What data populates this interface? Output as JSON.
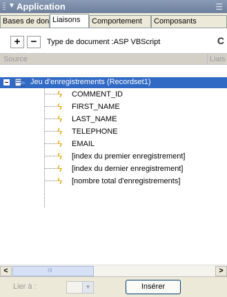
{
  "panel": {
    "title": "Application",
    "menu_icon": "panel-options-icon"
  },
  "tabs": [
    {
      "label": "Bases de donn",
      "active": false
    },
    {
      "label": "Liaisons",
      "active": true
    },
    {
      "label": "Comportement",
      "active": false
    },
    {
      "label": "Composants",
      "active": false
    }
  ],
  "toolbar": {
    "add_label": "+",
    "remove_label": "−",
    "doctype_label": "Type de document :ASP VBScript",
    "refresh_label": "C"
  },
  "columns": {
    "source": "Source",
    "binding": "Liais"
  },
  "tree": {
    "root_label": "Jeu d'enregistrements (Recordset1)",
    "fields": [
      "COMMENT_ID",
      "FIRST_NAME",
      "LAST_NAME",
      "TELEPHONE",
      "EMAIL",
      "[index du premier enregistrement]",
      "[index du dernier enregistrement]",
      "[nombre total d'enregistrements]"
    ]
  },
  "scrollbar": {
    "left_arrow": "<",
    "right_arrow": ">"
  },
  "bottom": {
    "bind_label": "Lier à :",
    "insert_label": "Insérer"
  },
  "colors": {
    "selection": "#316ac5",
    "titlebar": "#7b8cab",
    "bolt": "#e6a800"
  }
}
